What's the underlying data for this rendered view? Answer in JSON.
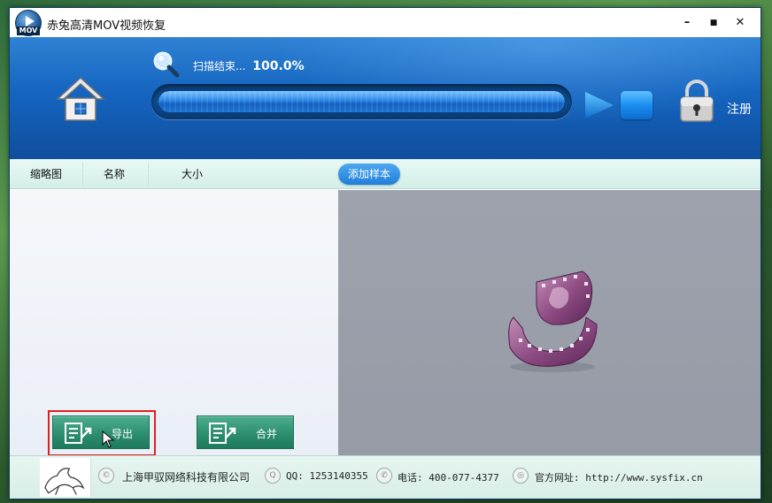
{
  "window": {
    "title": "赤兔高清MOV视频恢复",
    "icon_label": "MOV",
    "minimize": "–",
    "maximize": "■",
    "close": "✕"
  },
  "header": {
    "scan_status_text": "扫描结束...",
    "scan_percent": "100.0%",
    "progress_fraction": 1.0,
    "register_label": "注册"
  },
  "columns": {
    "thumbnail": "缩略图",
    "name": "名称",
    "size": "大小",
    "add_sample_button": "添加样本"
  },
  "actions": {
    "export_label": "导出",
    "merge_label": "合并"
  },
  "footer": {
    "company": "上海甲驭网络科技有限公司",
    "qq": "QQ: 1253140355",
    "phone": "电话: 400-077-4377",
    "website": "官方网址: http://www.sysfix.cn"
  },
  "colors": {
    "header_blue": "#1565c0",
    "action_green": "#2a8c6c",
    "highlight_red": "#e0201e"
  }
}
